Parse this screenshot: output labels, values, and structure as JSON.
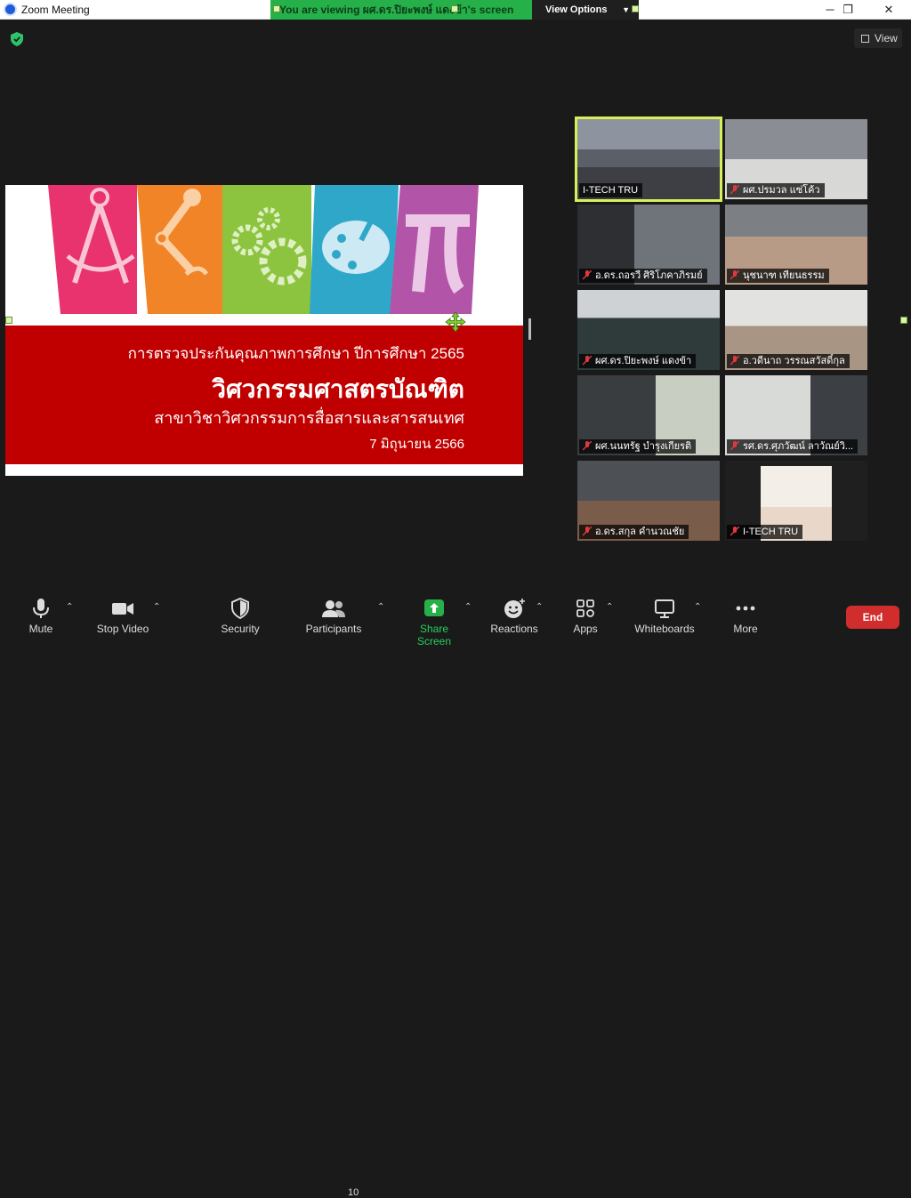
{
  "window": {
    "title": "Zoom Meeting",
    "minimize": "─",
    "maximize": "❐",
    "close": "✕"
  },
  "banner": {
    "text": "You are viewing ผศ.ดร.ปิยะพงษ์ แดงข้า's screen",
    "view_options": "View Options"
  },
  "top": {
    "view_label": "View"
  },
  "slide": {
    "line1": "การตรวจประกันคุณภาพการศึกษา ปีการศึกษา 2565",
    "line2": "วิศวกรรมศาสตรบัณฑิต",
    "line3": "สาขาวิชาวิศวกรรมการสื่อสารและสารสนเทศ",
    "line4": "7 มิถุนายน 2566",
    "strip_colors": [
      "#e8336f",
      "#f08426",
      "#8cc43f",
      "#2fa7c9",
      "#b254a8"
    ]
  },
  "participants": [
    {
      "name": "I-TECH TRU",
      "muted": false
    },
    {
      "name": "ผศ.ปรมวล แซ่โค้ว",
      "muted": true
    },
    {
      "name": "อ.ดร.ถอรวี ศิริโภคาภิรมย์",
      "muted": true
    },
    {
      "name": "นุชนาฑ เทียนธรรม",
      "muted": true
    },
    {
      "name": "ผศ.ดร.ปิยะพงษ์ แดงข้า",
      "muted": true
    },
    {
      "name": "อ.วดีนาถ วรรณสวัสดิ์กุล",
      "muted": true
    },
    {
      "name": "ผศ.นนทรัฐ บำรุงเกียรติ",
      "muted": true
    },
    {
      "name": "รศ.ดร.ศุภวัฒน์ ลาวัณย์วิ...",
      "muted": true
    },
    {
      "name": "อ.ดร.สกุล คำนวณชัย",
      "muted": true
    },
    {
      "name": "I-TECH TRU",
      "muted": true
    }
  ],
  "toolbar": {
    "mute": "Mute",
    "stop_video": "Stop Video",
    "security": "Security",
    "participants": "Participants",
    "participants_count": "10",
    "share_screen": "Share Screen",
    "reactions": "Reactions",
    "apps": "Apps",
    "whiteboards": "Whiteboards",
    "more": "More",
    "end": "End"
  },
  "colors": {
    "share_green": "#26b04a",
    "end_red": "#d22d2d",
    "slide_red": "#c00000",
    "active_border": "#d6f05a"
  }
}
